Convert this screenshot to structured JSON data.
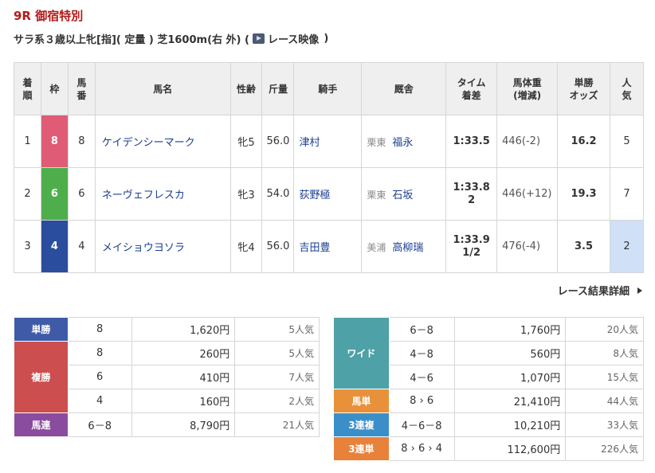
{
  "race": {
    "title": "9R 御宿特別",
    "condition_prefix": "サラ系３歳以上牝[指]( 定量 ) 芝1600m(右 外) (",
    "video_label": "レース映像",
    "condition_suffix": ")"
  },
  "results": {
    "headers": [
      [
        "着",
        "順"
      ],
      [
        "枠"
      ],
      [
        "馬",
        "番"
      ],
      [
        "馬名"
      ],
      [
        "性齢"
      ],
      [
        "斤量"
      ],
      [
        "騎手"
      ],
      [
        "厩舎"
      ],
      [
        "タイム",
        "着差"
      ],
      [
        "馬体重",
        "(増減)"
      ],
      [
        "単勝",
        "オッズ"
      ],
      [
        "人",
        "気"
      ]
    ],
    "rows": [
      {
        "rank": "1",
        "waku": "8",
        "waku_color": "#e05b76",
        "num": "8",
        "horse": "ケイデンシーマーク",
        "sex_age": "牝5",
        "weight": "56.0",
        "jockey": "津村",
        "area": "栗東",
        "trainer": "福永",
        "time": "1:33.5",
        "margin": "",
        "body": "446(-2)",
        "odds": "16.2",
        "pop": "5",
        "pop_hi": false
      },
      {
        "rank": "2",
        "waku": "6",
        "waku_color": "#4eae4b",
        "num": "6",
        "horse": "ネーヴェフレスカ",
        "sex_age": "牝3",
        "weight": "54.0",
        "jockey": "荻野極",
        "area": "栗東",
        "trainer": "石坂",
        "time": "1:33.8",
        "margin": "2",
        "body": "446(+12)",
        "odds": "19.3",
        "pop": "7",
        "pop_hi": false
      },
      {
        "rank": "3",
        "waku": "4",
        "waku_color": "#2b4d9e",
        "num": "4",
        "horse": "メイショウヨソラ",
        "sex_age": "牝4",
        "weight": "56.0",
        "jockey": "吉田豊",
        "area": "美浦",
        "trainer": "高柳瑞",
        "time": "1:33.9",
        "margin": "1/2",
        "body": "476(-4)",
        "odds": "3.5",
        "pop": "2",
        "pop_hi": true
      }
    ]
  },
  "detail_link": "レース結果詳細",
  "payout_left": [
    {
      "label": "単勝",
      "color": "#3f5ba8",
      "entries": [
        {
          "combo": "8",
          "yen": "1,620円",
          "pop": "5人気"
        }
      ]
    },
    {
      "label": "複勝",
      "color": "#cc4e4e",
      "entries": [
        {
          "combo": "8",
          "yen": "260円",
          "pop": "5人気"
        },
        {
          "combo": "6",
          "yen": "410円",
          "pop": "7人気"
        },
        {
          "combo": "4",
          "yen": "160円",
          "pop": "2人気"
        }
      ]
    },
    {
      "label": "馬連",
      "color": "#8a4c9e",
      "entries": [
        {
          "combo": "6－8",
          "yen": "8,790円",
          "pop": "21人気"
        }
      ]
    }
  ],
  "payout_right": [
    {
      "label": "ワイド",
      "color": "#4ea1a6",
      "entries": [
        {
          "combo": "6－8",
          "yen": "1,760円",
          "pop": "20人気"
        },
        {
          "combo": "4－8",
          "yen": "560円",
          "pop": "8人気"
        },
        {
          "combo": "4－6",
          "yen": "1,070円",
          "pop": "15人気"
        }
      ]
    },
    {
      "label": "馬単",
      "color": "#e8913a",
      "entries": [
        {
          "combo": "8 › 6",
          "yen": "21,410円",
          "pop": "44人気"
        }
      ]
    },
    {
      "label": "3連複",
      "color": "#3b8fc8",
      "entries": [
        {
          "combo": "4－6－8",
          "yen": "10,210円",
          "pop": "33人気"
        }
      ]
    },
    {
      "label": "3連単",
      "color": "#e8813a",
      "entries": [
        {
          "combo": "8 › 6 › 4",
          "yen": "112,600円",
          "pop": "226人気"
        }
      ]
    }
  ]
}
